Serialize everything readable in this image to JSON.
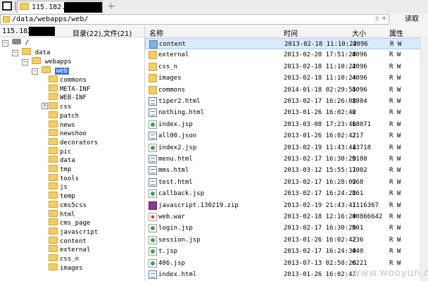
{
  "tab": {
    "title": "115.182."
  },
  "address": {
    "path": "/data/webapps/web/",
    "extra": "± ▾",
    "read_label": "读取"
  },
  "left_header": {
    "ip": "115.182.",
    "info": "目录(22),文件(21)"
  },
  "tree": {
    "root": "/",
    "data": "data",
    "webapps": "webapps",
    "web": "web",
    "children": [
      "commons",
      "META-INF",
      "WEB-INF",
      "css",
      "patch",
      "news",
      "newshoo",
      "decorators",
      "pic",
      "data",
      "tmp",
      "tools",
      "js",
      "temp",
      "cms5css",
      "html",
      "cms_page",
      "javascript",
      "content",
      "external",
      "css_n",
      "images"
    ]
  },
  "columns": {
    "name": "名称",
    "time": "时间",
    "size": "大小",
    "attr": "属性"
  },
  "files": [
    {
      "name": "content",
      "date": "2013-02-18 11:10:22",
      "size": "4096",
      "attr": "R W",
      "icon": "folder-blue"
    },
    {
      "name": "external",
      "date": "2013-02-20 17:51:28",
      "size": "4096",
      "attr": "R W",
      "icon": "folder"
    },
    {
      "name": "css_n",
      "date": "2013-02-18 11:10:22",
      "size": "4096",
      "attr": "R W",
      "icon": "folder"
    },
    {
      "name": "images",
      "date": "2013-02-18 11:10:24",
      "size": "4096",
      "attr": "R W",
      "icon": "folder"
    },
    {
      "name": "commons",
      "date": "2014-01-18 02:29:55",
      "size": "4096",
      "attr": "R W",
      "icon": "folder"
    },
    {
      "name": "tiper2.html",
      "date": "2013-02-17 16:26:08",
      "size": "1804",
      "attr": "R W",
      "icon": "doc"
    },
    {
      "name": "nothing.html",
      "date": "2013-01-26 16:02:42",
      "size": "0",
      "attr": "R W",
      "icon": "doc"
    },
    {
      "name": "index.jsp",
      "date": "2013-03-08 17:23:46",
      "size": "18071",
      "attr": "R W",
      "icon": "jsp"
    },
    {
      "name": "all00.json",
      "date": "2013-01-26 16:02:42",
      "size": "217",
      "attr": "R W",
      "icon": "doc"
    },
    {
      "name": "index2.jsp",
      "date": "2013-02-19 11:43:44",
      "size": "13718",
      "attr": "R W",
      "icon": "jsp"
    },
    {
      "name": "menu.html",
      "date": "2013-02-17 16:30:20",
      "size": "5180",
      "attr": "R W",
      "icon": "doc"
    },
    {
      "name": "mms.html",
      "date": "2013-03-12 15:55:11",
      "size": "7002",
      "attr": "R W",
      "icon": "doc"
    },
    {
      "name": "test.html",
      "date": "2013-02-17 16:28:02",
      "size": "968",
      "attr": "R W",
      "icon": "doc"
    },
    {
      "name": "callback.jsp",
      "date": "2013-02-17 16:24:24",
      "size": "561",
      "attr": "R W",
      "icon": "jsp"
    },
    {
      "name": "javascript.130219.zip",
      "date": "2013-02-19 21:43:41",
      "size": "1116367",
      "attr": "R W",
      "icon": "zip"
    },
    {
      "name": "web.war",
      "date": "2013-02-18 12:16:29",
      "size": "40866642",
      "attr": "R W",
      "icon": "war"
    },
    {
      "name": "login.jsp",
      "date": "2013-02-17 16:30:20",
      "size": "501",
      "attr": "R W",
      "icon": "jsp"
    },
    {
      "name": "session.jsp",
      "date": "2013-01-26 16:02:42",
      "size": "236",
      "attr": "R W",
      "icon": "jsp"
    },
    {
      "name": "t.jsp",
      "date": "2013-02-17 16:24:30",
      "size": "440",
      "attr": "R W",
      "icon": "jsp"
    },
    {
      "name": "406.jsp",
      "date": "2013-07-13 02:58:28",
      "size": "6221",
      "attr": "R W",
      "icon": "jsp"
    },
    {
      "name": "index.html",
      "date": "2013-01-26 16:02:42",
      "size": "",
      "attr": "",
      "icon": "doc"
    }
  ],
  "watermark": "www.wooyun.org"
}
